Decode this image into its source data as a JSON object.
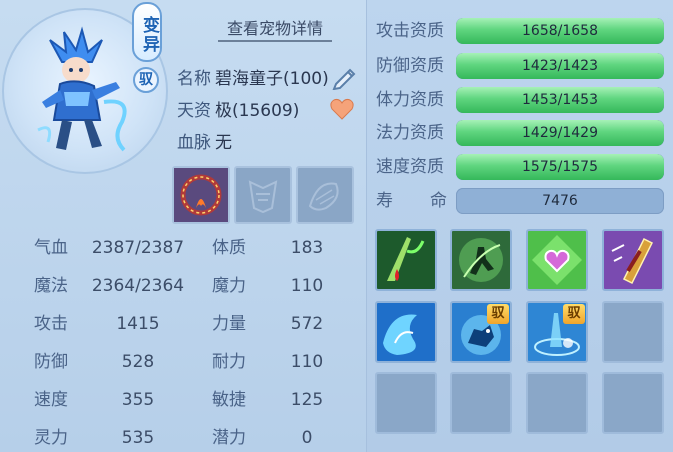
{
  "header": {
    "transform_badge": "变异",
    "tame_badge": "驭",
    "detail_link": "查看宠物详情"
  },
  "info": {
    "name_label": "名称",
    "name_value": "碧海童子(100)",
    "talent_label": "天资",
    "talent_value": "极(15609)",
    "bloodline_label": "血脉",
    "bloodline_value": "无"
  },
  "attributes": [
    {
      "label": "气血",
      "value": "2387/2387"
    },
    {
      "label": "魔法",
      "value": "2364/2364"
    },
    {
      "label": "攻击",
      "value": "1415"
    },
    {
      "label": "防御",
      "value": "528"
    },
    {
      "label": "速度",
      "value": "355"
    },
    {
      "label": "灵力",
      "value": "535"
    }
  ],
  "stats": [
    {
      "label": "体质",
      "value": "183"
    },
    {
      "label": "魔力",
      "value": "110"
    },
    {
      "label": "力量",
      "value": "572"
    },
    {
      "label": "耐力",
      "value": "110"
    },
    {
      "label": "敏捷",
      "value": "125"
    },
    {
      "label": "潜力",
      "value": "0"
    }
  ],
  "aptitudes": [
    {
      "label": "攻击资质",
      "value": "1658/1658",
      "fill": 1.0
    },
    {
      "label": "防御资质",
      "value": "1423/1423",
      "fill": 1.0
    },
    {
      "label": "体力资质",
      "value": "1453/1453",
      "fill": 1.0
    },
    {
      "label": "法力资质",
      "value": "1429/1429",
      "fill": 1.0
    },
    {
      "label": "速度资质",
      "value": "1575/1575",
      "fill": 1.0
    }
  ],
  "lifespan": {
    "label_a": "寿",
    "label_b": "命",
    "value": "7476"
  },
  "skills": {
    "tame_tag": "驭",
    "icons": [
      "blood-drain-skill-icon",
      "shadow-warrior-skill-icon",
      "heart-shield-skill-icon",
      "golden-blade-skill-icon",
      "water-wave-skill-icon",
      "water-beast-skill-icon",
      "water-magic-circle-skill-icon"
    ]
  },
  "colors": {
    "accent": "#1d63b4",
    "bar_green": "#4fcf73",
    "panel_bg": "#bdd5ee"
  }
}
